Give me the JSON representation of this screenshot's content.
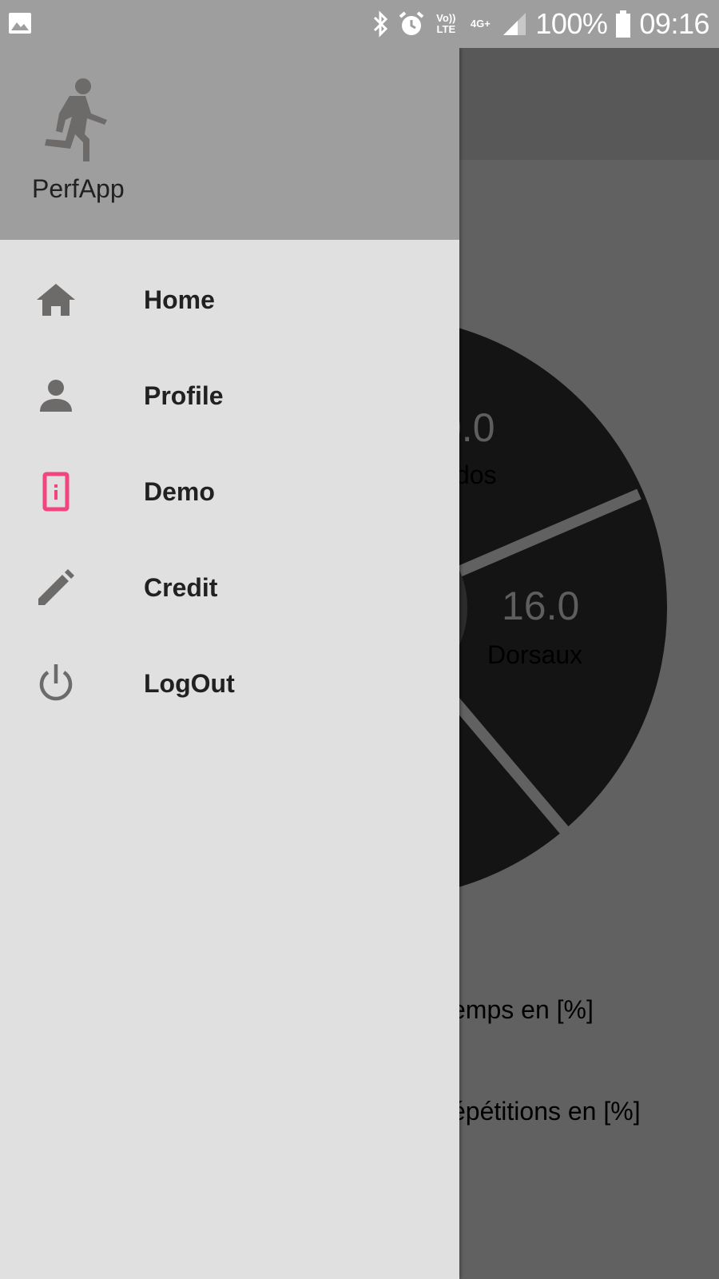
{
  "status_bar": {
    "left_icon": "image-icon",
    "icons": [
      "bluetooth-icon",
      "alarm-icon",
      "volte-icon",
      "network-4g-icon",
      "signal-icon",
      "battery-icon"
    ],
    "volte_label": "Vo)) LTE",
    "network_label": "4G+",
    "battery": "100%",
    "time": "09:16"
  },
  "drawer": {
    "header": {
      "app_icon": "running-person-icon",
      "app_name": "PerfApp"
    },
    "items": [
      {
        "label": "Home",
        "icon": "home-icon"
      },
      {
        "label": "Profile",
        "icon": "person-icon"
      },
      {
        "label": "Demo",
        "icon": "demo-icon",
        "icon_color": "#f2447e"
      },
      {
        "label": "Credit",
        "icon": "pencil-icon"
      },
      {
        "label": "LogOut",
        "icon": "power-icon"
      }
    ]
  },
  "background": {
    "chart_visible": [
      {
        "value": "0.0",
        "label": "dos"
      },
      {
        "value": "16.0",
        "label": "Dorsaux"
      }
    ],
    "legend": [
      "emps en [%]",
      "épétitions en [%]"
    ]
  },
  "colors": {
    "status_bar": "#9e9e9e",
    "drawer_header": "#9e9e9e",
    "drawer_body": "#e0e0e0",
    "scrim": "#616161",
    "accent": "#f2447e",
    "icon_gray": "#6d6a6a"
  }
}
